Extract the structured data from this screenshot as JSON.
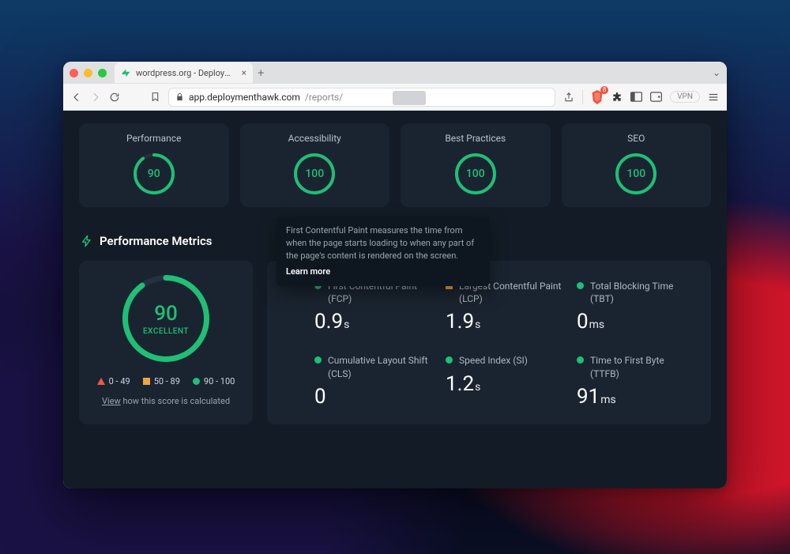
{
  "browser": {
    "tab_title": "wordpress.org - DeploymentHa",
    "new_tab_glyph": "+",
    "url_host": "app.deploymenthawk.com",
    "url_path": "/reports/",
    "vpn_label": "VPN",
    "shield_badge": "8"
  },
  "scores": [
    {
      "label": "Performance",
      "value": "90",
      "pct": 90
    },
    {
      "label": "Accessibility",
      "value": "100",
      "pct": 100
    },
    {
      "label": "Best Practices",
      "value": "100",
      "pct": 100
    },
    {
      "label": "SEO",
      "value": "100",
      "pct": 100
    }
  ],
  "perf_metrics": {
    "heading": "Performance Metrics",
    "overall": {
      "value": "90",
      "pct": 90,
      "label": "EXCELLENT"
    },
    "legend": {
      "low": "0 - 49",
      "mid": "50 - 89",
      "high": "90 - 100"
    },
    "view_link_prefix": "View",
    "view_link_rest": " how this score is calculated",
    "tooltip_text": "First Contentful Paint measures the time from when the page starts loading to when any part of the page's content is rendered on the screen.",
    "tooltip_learn": "Learn more",
    "items": [
      {
        "status": "g",
        "name": "First Contentful Paint (FCP)",
        "value": "0.9",
        "unit": "s"
      },
      {
        "status": "o",
        "name": "Largest Contentful Paint (LCP)",
        "value": "1.9",
        "unit": "s"
      },
      {
        "status": "g",
        "name": "Total Blocking Time (TBT)",
        "value": "0",
        "unit": "ms"
      },
      {
        "status": "g",
        "name": "Cumulative Layout Shift (CLS)",
        "value": "0",
        "unit": ""
      },
      {
        "status": "g",
        "name": "Speed Index (SI)",
        "value": "1.2",
        "unit": "s"
      },
      {
        "status": "g",
        "name": "Time to First Byte (TTFB)",
        "value": "91",
        "unit": "ms"
      }
    ]
  },
  "colors": {
    "accent": "#1fbf75",
    "warn": "#f2a33a",
    "bad": "#f05a3a",
    "card": "#1a2430",
    "bg": "#131c26"
  }
}
